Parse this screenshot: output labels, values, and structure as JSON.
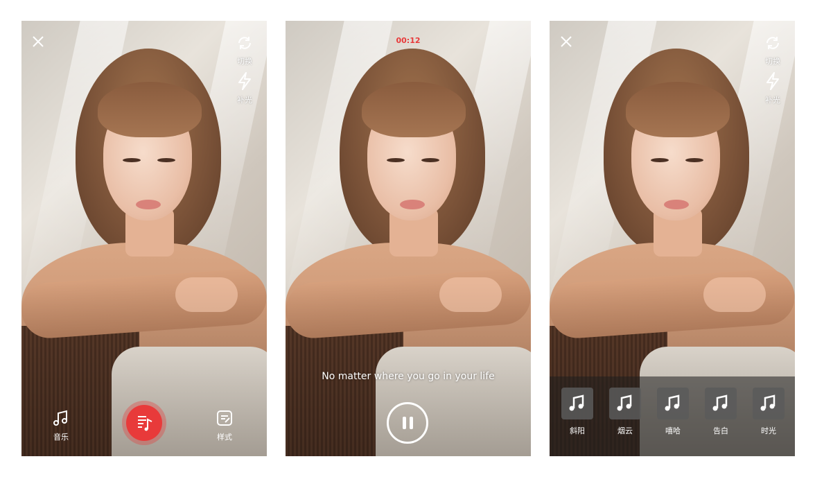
{
  "screen1": {
    "side_controls": [
      {
        "label": "切换",
        "icon": "refresh-icon"
      },
      {
        "label": "补光",
        "icon": "flash-icon"
      }
    ],
    "bottom": {
      "music_label": "音乐",
      "style_label": "样式"
    }
  },
  "screen2": {
    "timer": "00:12",
    "lyric": "No matter where you go in your life"
  },
  "screen3": {
    "side_controls": [
      {
        "label": "切换",
        "icon": "refresh-icon"
      },
      {
        "label": "补光",
        "icon": "flash-icon"
      }
    ],
    "music_styles": [
      {
        "label": "斜阳"
      },
      {
        "label": "烟云"
      },
      {
        "label": "嘻哈"
      },
      {
        "label": "告白"
      },
      {
        "label": "时光"
      }
    ]
  },
  "colors": {
    "accent": "#e83a3a",
    "timer": "#e83a3a"
  }
}
